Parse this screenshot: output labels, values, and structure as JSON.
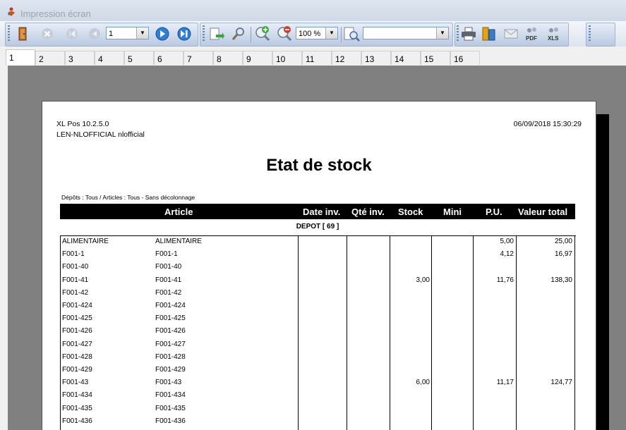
{
  "window": {
    "title": "Impression écran"
  },
  "toolbar": {
    "page_value": "1",
    "zoom_value": "100 %",
    "search_value": "",
    "buttons": [
      "exit-icon",
      "close-icon",
      "first-page-icon",
      "previous-page-icon",
      "next-page-icon",
      "last-page-icon",
      "page-setup-icon",
      "search-icon",
      "zoom-in-icon",
      "zoom-out-icon",
      "find-icon",
      "print-icon",
      "export-icon",
      "email-icon",
      "pdf-icon",
      "xls-icon"
    ]
  },
  "tabs": [
    "1",
    "2",
    "3",
    "4",
    "5",
    "6",
    "7",
    "8",
    "9",
    "10",
    "11",
    "12",
    "13",
    "14",
    "15",
    "16"
  ],
  "report": {
    "app_version": "XL Pos 10.2.5.0",
    "user": "LEN-NLOFFICIAL nlofficial",
    "datetime": "06/09/2018 15:30:29",
    "title": "Etat de stock",
    "filters": "Dépôts : Tous / Articles : Tous - Sans décolonnage",
    "columns": {
      "article": "Article",
      "date_inv": "Date inv.",
      "qte_inv": "Qté inv.",
      "stock": "Stock",
      "mini": "Mini",
      "pu": "P.U.",
      "valeur": "Valeur total"
    },
    "depot": "DEPOT [ 69 ]",
    "rows": [
      {
        "code": "ALIMENTAIRE",
        "label": "ALIMENTAIRE",
        "stock": "",
        "pu": "5,00",
        "valeur": "25,00"
      },
      {
        "code": "F001-1",
        "label": "F001-1",
        "stock": "",
        "pu": "4,12",
        "valeur": "16,97"
      },
      {
        "code": "F001-40",
        "label": "F001-40",
        "stock": "",
        "pu": "",
        "valeur": ""
      },
      {
        "code": "F001-41",
        "label": "F001-41",
        "stock": "3,00",
        "pu": "11,76",
        "valeur": "138,30"
      },
      {
        "code": "F001-42",
        "label": "F001-42",
        "stock": "",
        "pu": "",
        "valeur": ""
      },
      {
        "code": "F001-424",
        "label": "F001-424",
        "stock": "",
        "pu": "",
        "valeur": ""
      },
      {
        "code": "F001-425",
        "label": "F001-425",
        "stock": "",
        "pu": "",
        "valeur": ""
      },
      {
        "code": "F001-426",
        "label": "F001-426",
        "stock": "",
        "pu": "",
        "valeur": ""
      },
      {
        "code": "F001-427",
        "label": "F001-427",
        "stock": "",
        "pu": "",
        "valeur": ""
      },
      {
        "code": "F001-428",
        "label": "F001-428",
        "stock": "",
        "pu": "",
        "valeur": ""
      },
      {
        "code": "F001-429",
        "label": "F001-429",
        "stock": "",
        "pu": "",
        "valeur": ""
      },
      {
        "code": "F001-43",
        "label": "F001-43",
        "stock": "6,00",
        "pu": "11,17",
        "valeur": "124,77"
      },
      {
        "code": "F001-434",
        "label": "F001-434",
        "stock": "",
        "pu": "",
        "valeur": ""
      },
      {
        "code": "F001-435",
        "label": "F001-435",
        "stock": "",
        "pu": "",
        "valeur": ""
      },
      {
        "code": "F001-436",
        "label": "F001-436",
        "stock": "",
        "pu": "",
        "valeur": ""
      }
    ]
  }
}
